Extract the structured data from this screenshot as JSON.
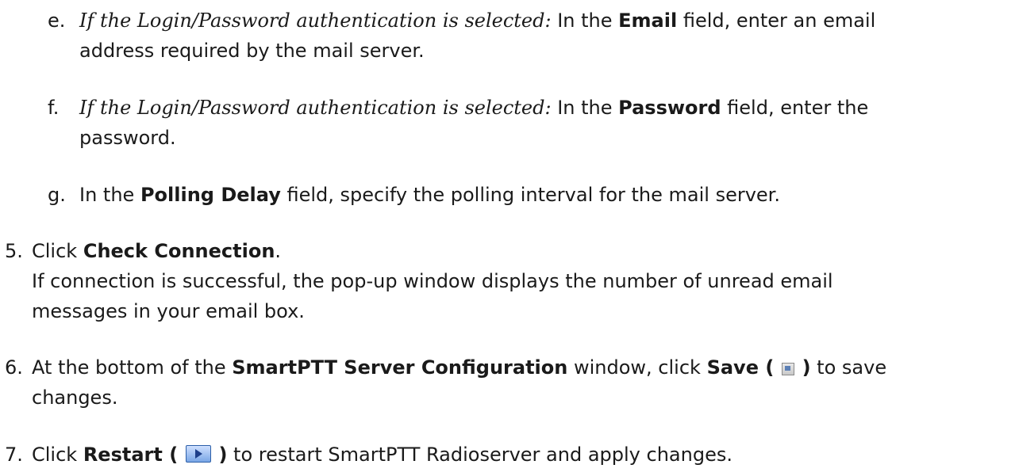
{
  "steps": {
    "e": {
      "marker": "e.",
      "cond": "If the Login/Password authentication is selected:",
      "t1": " In the ",
      "b1": "Email",
      "t2": " field, enter an email",
      "line2": "address required by the mail server."
    },
    "f": {
      "marker": "f.",
      "cond": "If the Login/Password authentication is selected:",
      "t1": " In the ",
      "b1": "Password",
      "t2": " field, enter the",
      "line2": "password."
    },
    "g": {
      "marker": "g.",
      "t1": "In the ",
      "b1": "Polling Delay",
      "t2": " field, specify the polling interval for the mail server."
    },
    "s5": {
      "marker": "5.",
      "t1": "Click ",
      "b1": "Check Connection",
      "t2": ".",
      "line2": "If connection is successful, the pop-up window displays the number of unread email",
      "line3": "messages in your email box."
    },
    "s6": {
      "marker": "6.",
      "t1": "At the bottom of the ",
      "b1": "SmartPTT Server Configuration",
      "t2": " window, click ",
      "b2a": "Save (",
      "b2b": ")",
      "t3": " to save",
      "line2": "changes."
    },
    "s7": {
      "marker": "7.",
      "t1": "Click ",
      "b1a": "Restart (",
      "b1b": ")",
      "t2": " to restart SmartPTT Radioserver and apply changes."
    }
  },
  "icons": {
    "save": "save-icon",
    "restart": "restart-icon"
  }
}
